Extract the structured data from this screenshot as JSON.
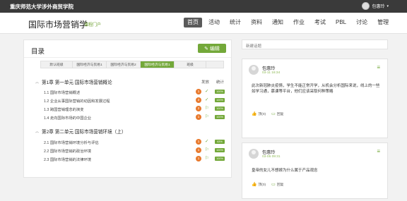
{
  "topbar": {
    "school": "重庆师范大学涉外商贸学院",
    "user": "包惠玲"
  },
  "header": {
    "title": "国际市场营销学",
    "subtitle": "课程门户",
    "nav": [
      "首页",
      "活动",
      "统计",
      "资料",
      "通知",
      "作业",
      "考试",
      "PBL",
      "讨论",
      "管理"
    ],
    "active_nav": "首页"
  },
  "catalog": {
    "title": "目录",
    "edit_label": "编辑",
    "tabs": [
      "默认班级",
      "国际经济与贸易1",
      "国际经济与贸易2",
      "国际经济与贸易1",
      "班级"
    ],
    "active_tab": 3,
    "col_publish": "发放",
    "col_stats": "统计",
    "chapters": [
      {
        "title": "第1章 第一单元 国际市场营销概论",
        "sections": [
          {
            "label": "1.1  国际市场营销概述",
            "num": "1",
            "icon": "check-icon",
            "pct": "100%"
          },
          {
            "label": "1.2  企业从事国际营销的动因和发展过程",
            "num": "2",
            "icon": "check-icon",
            "pct": "100%"
          },
          {
            "label": "1.3  跨国营销理念的演变",
            "num": "2",
            "icon": "flag-icon",
            "pct": "100%"
          },
          {
            "label": "1.4  走向国际市场的中国企业",
            "num": "1",
            "icon": "flag-icon",
            "pct": "100%"
          }
        ]
      },
      {
        "title": "第2章 第二单元 国际市场营销环境（上）",
        "sections": [
          {
            "label": "2.1  国际市场营销环境分析与评估",
            "num": "1",
            "icon": "check-icon",
            "pct": "63%"
          },
          {
            "label": "2.2  国际市场营销的政治环境",
            "num": "1",
            "icon": "flag-icon",
            "pct": "100%"
          },
          {
            "label": "2.3  国际市场营销的法律环境",
            "num": "1",
            "icon": "flag-icon",
            "pct": "100%"
          }
        ]
      }
    ]
  },
  "discussion": {
    "search_placeholder": "新建话题",
    "posts": [
      {
        "name": "包惠玲",
        "date": "03-11 16:34",
        "body": "此次新冠肺炎疫情，学生不能正常开学，从机会分析国际来说，线上的一些如学习通，慕课等平台，他们应该采取何种策略",
        "like": "顶(0)",
        "reply": "回复"
      },
      {
        "name": "包惠玲",
        "date": "03-05 09:31",
        "body": "皇帝的女儿不想嫁为什么属于产品观念",
        "like": "顶(0)",
        "reply": "回复"
      }
    ]
  },
  "colors": {
    "accent": "#73a839",
    "orange": "#e87a2e",
    "topbar": "#3a3a3a"
  }
}
